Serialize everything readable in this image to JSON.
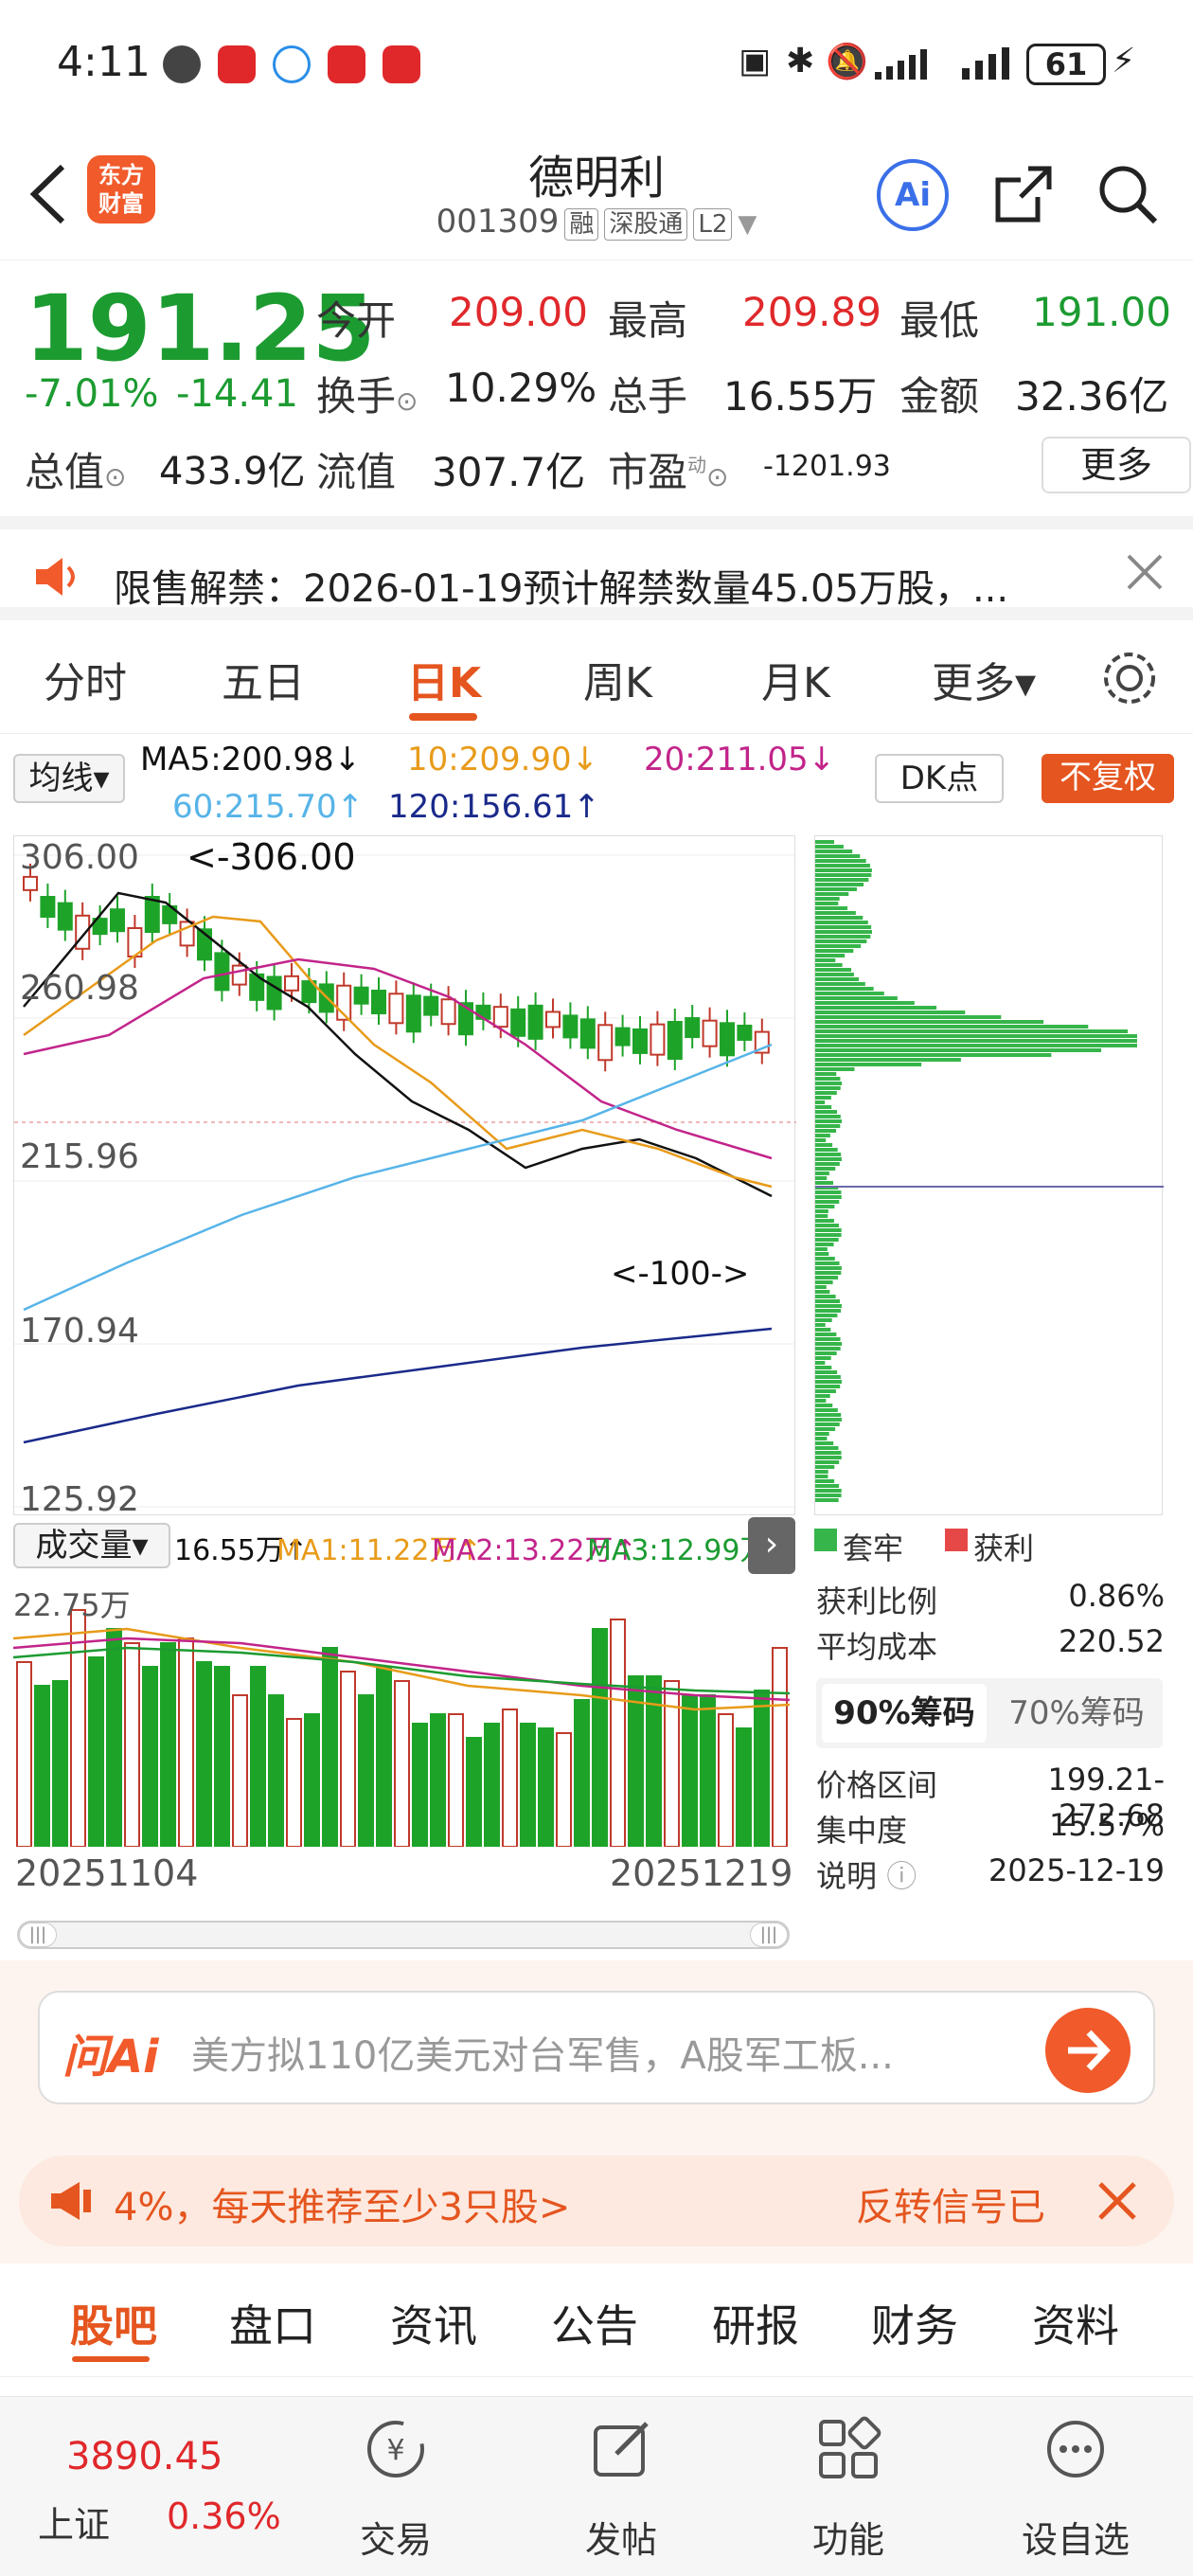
{
  "status_bar": {
    "time": "4:11",
    "battery": "61"
  },
  "header": {
    "back_icon": "chevron-left-icon",
    "logo_text_1": "东方",
    "logo_text_2": "财富",
    "stock_name": "德明利",
    "stock_code": "001309",
    "badges": [
      "融",
      "深股通",
      "L2"
    ],
    "ai_label": "Ai"
  },
  "quote": {
    "price": "191.25",
    "change_pct": "-7.01%",
    "change_abs": "-14.41",
    "open_label": "今开",
    "open": "209.00",
    "high_label": "最高",
    "high": "209.89",
    "low_label": "最低",
    "low": "191.00",
    "turnover_label": "换手",
    "turnover": "10.29%",
    "volume_label": "总手",
    "volume": "16.55万",
    "amount_label": "金额",
    "amount": "32.36亿",
    "total_value_label": "总值",
    "total_value": "433.9亿",
    "float_value_label": "流值",
    "float_value": "307.7亿",
    "pe_label": "市盈",
    "pe_sup": "动",
    "pe": "-1201.93",
    "more_label": "更多"
  },
  "notice": {
    "text": "限售解禁：2026-01-19预计解禁数量45.05万股，..."
  },
  "chart_tabs": [
    "分时",
    "五日",
    "日K",
    "周K",
    "月K",
    "更多▾"
  ],
  "chart_tabs_active": 2,
  "ma": {
    "selector": "均线▾",
    "ma5": "MA5:200.98↓",
    "ma10": "10:209.90↓",
    "ma20": "20:211.05↓",
    "ma60": "60:215.70↑",
    "ma120": "120:156.61↑",
    "dk_label": "DK点",
    "fq_label": "不复权"
  },
  "kline": {
    "y_labels": [
      "306.00",
      "260.98",
      "215.96",
      "170.94",
      "125.92"
    ],
    "max_mark": "<-306.00",
    "mark_100": "<-100->",
    "colors": {
      "up": "#c0392b",
      "down": "#1ea329",
      "ma5": "#111111",
      "ma10": "#e89b1a",
      "ma20": "#c2248a",
      "ma60": "#57b4e8",
      "ma120": "#1a2a8a"
    }
  },
  "volume": {
    "selector": "成交量▾",
    "vol": "16.55万↑",
    "ma1": "MA1:11.22万↑",
    "ma2": "MA2:13.22万↑",
    "ma3": "MA3:12.99万↑",
    "top_label": "22.75万",
    "date_start": "20251104",
    "date_end": "20251219"
  },
  "chip": {
    "legend_trapped": "套牢",
    "legend_profit": "获利",
    "profit_ratio_label": "获利比例",
    "profit_ratio": "0.86%",
    "avg_cost_label": "平均成本",
    "avg_cost": "220.52",
    "tab_90": "90%筹码",
    "tab_70": "70%筹码",
    "range_label": "价格区间",
    "range": "199.21-272.68",
    "concentration_label": "集中度",
    "concentration": "15.57%",
    "note_label": "说明",
    "note_date": "2025-12-19"
  },
  "ai_bar": {
    "brand": "问Ai",
    "placeholder": "美方拟110亿美元对台军售，A股军工板..."
  },
  "promo": {
    "left": "4%，每天推荐至少3只股>",
    "right": "反转信号已"
  },
  "bottom_tabs": [
    "股吧",
    "盘口",
    "资讯",
    "公告",
    "研报",
    "财务",
    "资料"
  ],
  "navbar": {
    "index_value": "3890.45",
    "index_name": "上证",
    "index_change": "0.36%",
    "trade": "交易",
    "post": "发帖",
    "function": "功能",
    "watchlist": "设自选"
  }
}
